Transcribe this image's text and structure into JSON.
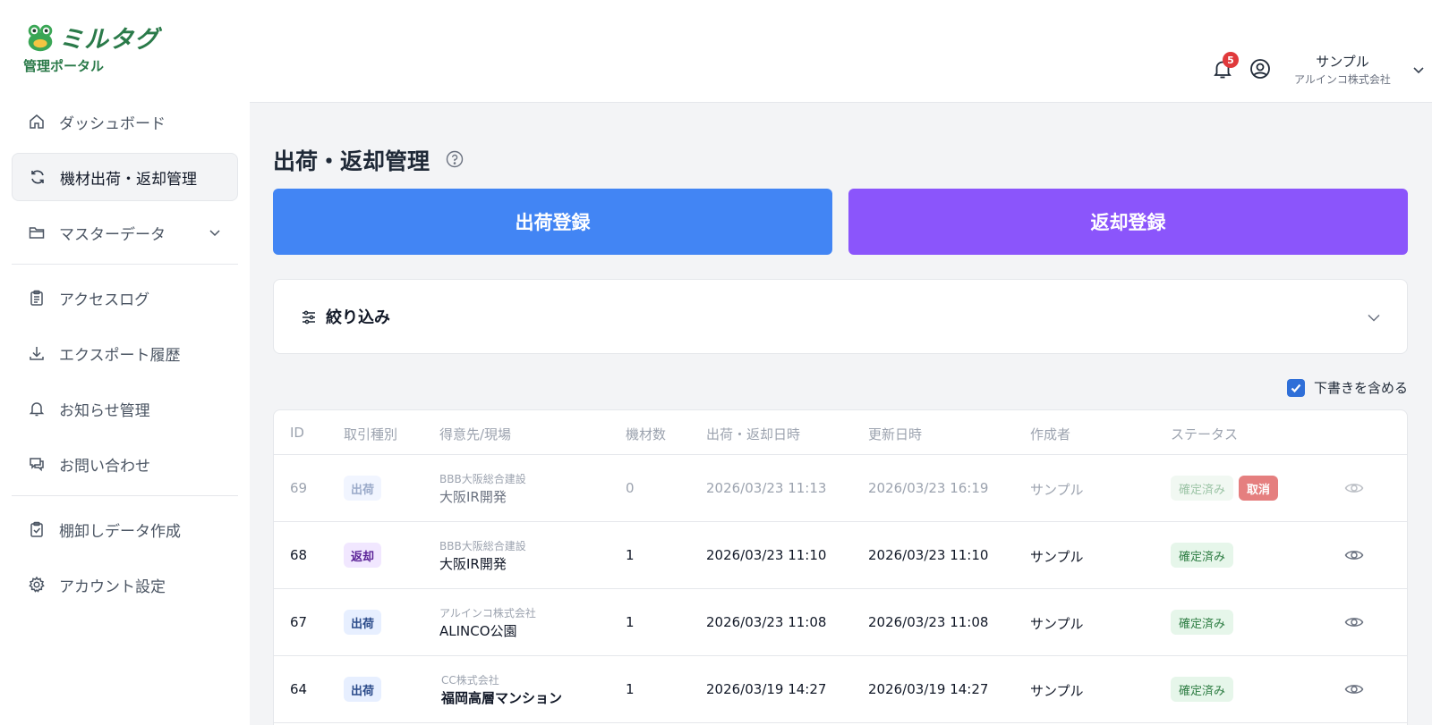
{
  "brand": {
    "name": "ミルタグ",
    "subtitle": "管理ポータル",
    "color": "#2a7a49"
  },
  "sidebar": {
    "items": [
      {
        "label": "ダッシュボード",
        "icon": "home-icon"
      },
      {
        "label": "機材出荷・返却管理",
        "icon": "refresh-icon",
        "active": true
      },
      {
        "label": "マスターデータ",
        "icon": "folder-icon",
        "expandable": true
      },
      {
        "label": "アクセスログ",
        "icon": "clipboard-icon"
      },
      {
        "label": "エクスポート履歴",
        "icon": "download-icon"
      },
      {
        "label": "お知らせ管理",
        "icon": "bell-icon"
      },
      {
        "label": "お問い合わせ",
        "icon": "chat-icon"
      },
      {
        "label": "棚卸しデータ作成",
        "icon": "clipboard-check-icon"
      },
      {
        "label": "アカウント設定",
        "icon": "gear-icon"
      }
    ]
  },
  "header": {
    "notification_count": "5",
    "user_name": "サンプル",
    "user_org": "アルインコ株式会社"
  },
  "main": {
    "title": "出荷・返却管理",
    "ship_button": "出荷登録",
    "return_button": "返却登録",
    "filter_label": "絞り込み",
    "include_drafts_label": "下書きを含める",
    "include_drafts_checked": true
  },
  "table": {
    "columns": [
      "ID",
      "取引種別",
      "得意先/現場",
      "機材数",
      "出荷・返却日時",
      "更新日時",
      "作成者",
      "ステータス"
    ],
    "rows": [
      {
        "id": "69",
        "type": "出荷",
        "type_kind": "ship",
        "customer": "BBB大阪総合建設",
        "site": "大阪IR開発",
        "count": "0",
        "date": "2026/03/23 11:13",
        "updated": "2026/03/23 16:19",
        "creator": "サンプル",
        "status": "確定済み",
        "cancel": "取消",
        "draft": true
      },
      {
        "id": "68",
        "type": "返却",
        "type_kind": "ret",
        "customer": "BBB大阪総合建設",
        "site": "大阪IR開発",
        "count": "1",
        "date": "2026/03/23 11:10",
        "updated": "2026/03/23 11:10",
        "creator": "サンプル",
        "status": "確定済み"
      },
      {
        "id": "67",
        "type": "出荷",
        "type_kind": "ship",
        "customer": "アルインコ株式会社",
        "site": "ALINCO公園",
        "count": "1",
        "date": "2026/03/23 11:08",
        "updated": "2026/03/23 11:08",
        "creator": "サンプル",
        "status": "確定済み"
      },
      {
        "id": "64",
        "type": "出荷",
        "type_kind": "ship",
        "customer": "CC株式会社",
        "site": "福岡高層マンション",
        "count": "1",
        "date": "2026/03/19 14:27",
        "updated": "2026/03/19 14:27",
        "creator": "サンプル",
        "status": "確定済み"
      }
    ]
  }
}
